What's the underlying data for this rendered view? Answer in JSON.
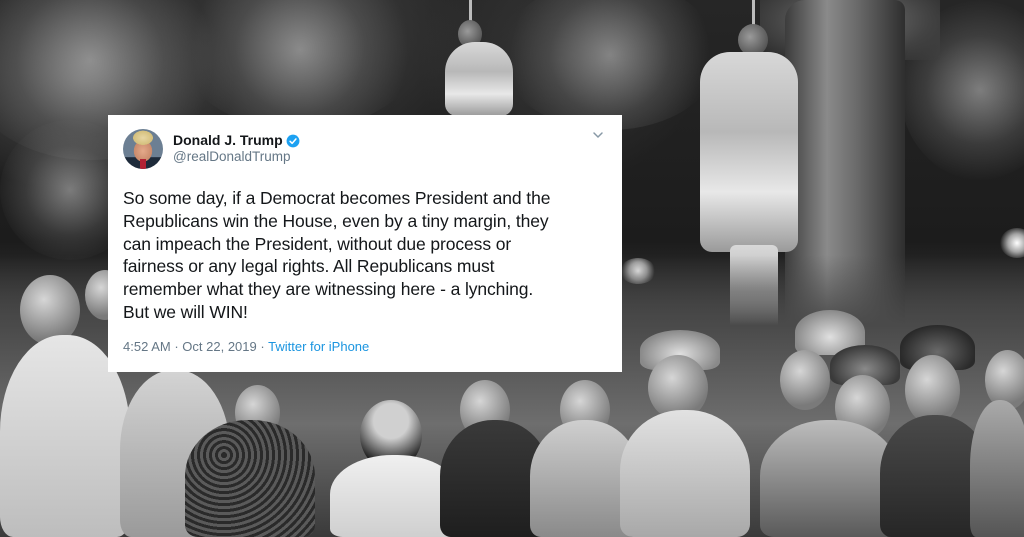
{
  "tweet": {
    "display_name": "Donald J. Trump",
    "handle": "@realDonaldTrump",
    "verified": true,
    "text": "So some day, if a Democrat becomes President and the\nRepublicans win the House, even by a tiny margin, they\ncan impeach the President, without due process or\nfairness or any legal rights. All Republicans must\nremember what they are witnessing here - a lynching.\nBut we will WIN!",
    "time": "4:52 AM",
    "separator": "·",
    "date": "Oct 22, 2019",
    "source": "Twitter for iPhone",
    "menu_icon": "chevron-down-icon",
    "accent_color": "#1b95e0",
    "verified_color": "#1da1f2"
  },
  "background": {
    "style": "black-and-white photograph"
  }
}
